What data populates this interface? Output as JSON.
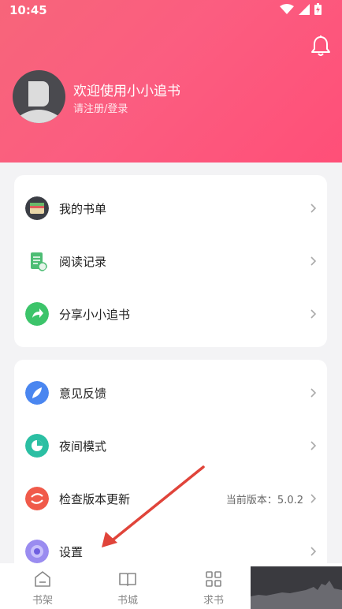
{
  "status_bar": {
    "time": "10:45"
  },
  "profile": {
    "welcome": "欢迎使用小小追书",
    "login_prompt": "请注册/登录"
  },
  "menu_group_1": [
    {
      "label": "我的书单",
      "icon": "bookshelf-wallet-icon"
    },
    {
      "label": "阅读记录",
      "icon": "reading-record-icon"
    },
    {
      "label": "分享小小追书",
      "icon": "share-icon"
    }
  ],
  "menu_group_2": [
    {
      "label": "意见反馈",
      "icon": "feedback-feather-icon"
    },
    {
      "label": "夜间模式",
      "icon": "night-mode-icon"
    },
    {
      "label": "检查版本更新",
      "icon": "update-icon",
      "extra": "当前版本：5.0.2"
    },
    {
      "label": "设置",
      "icon": "settings-icon"
    }
  ],
  "tabbar": [
    {
      "label": "书架",
      "icon": "home-bookshelf-icon"
    },
    {
      "label": "书城",
      "icon": "open-book-icon"
    },
    {
      "label": "求书",
      "icon": "grid-icon"
    }
  ],
  "colors": {
    "header": "#fb5d80",
    "arrow": "#e0443a"
  }
}
